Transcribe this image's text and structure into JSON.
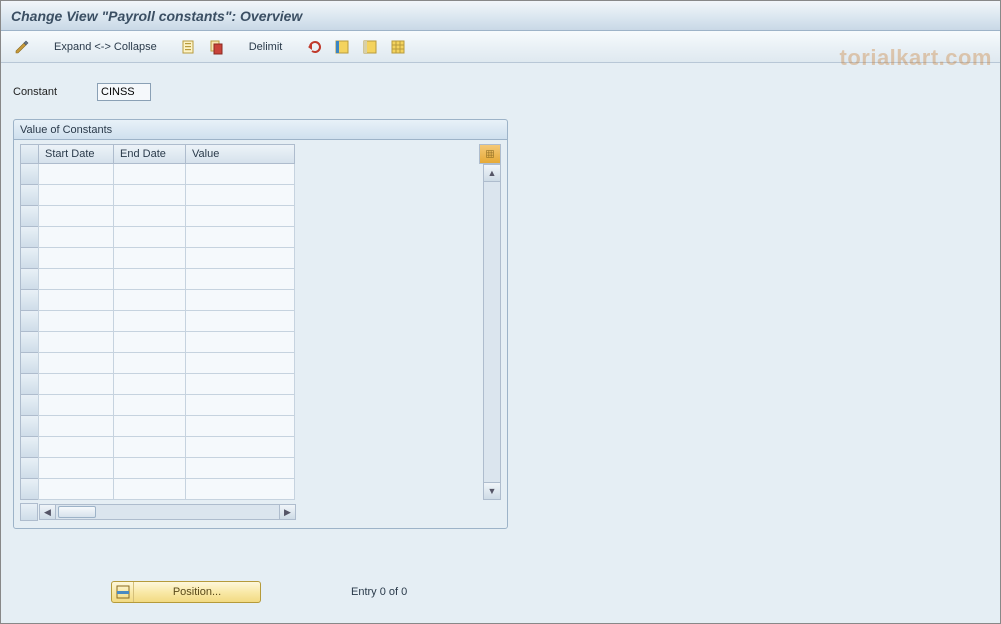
{
  "header": {
    "title": "Change View \"Payroll constants\": Overview"
  },
  "toolbar": {
    "expand_collapse_label": "Expand <-> Collapse",
    "delimit_label": "Delimit",
    "icons": {
      "pencil_tool": "pencil",
      "copy": "copy",
      "paste": "paste",
      "undo": "undo",
      "select_all": "select-all",
      "deselect_all": "deselect-all",
      "config": "config"
    }
  },
  "constant_field": {
    "label": "Constant",
    "value": "CINSS"
  },
  "groupbox": {
    "title": "Value of Constants"
  },
  "table": {
    "columns": {
      "start_date": "Start Date",
      "end_date": "End Date",
      "value": "Value"
    },
    "row_count": 16
  },
  "footer": {
    "position_label": "Position...",
    "entry_text": "Entry 0 of 0"
  },
  "watermark": {
    "text": "torialkart.com"
  }
}
